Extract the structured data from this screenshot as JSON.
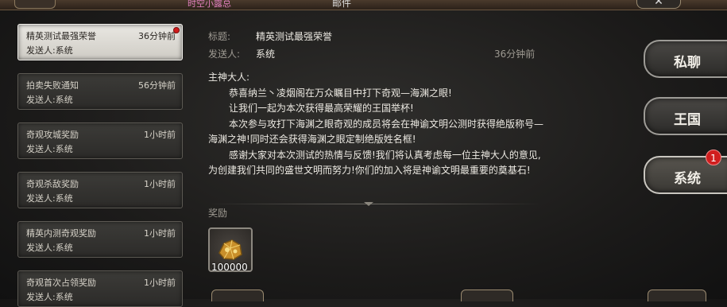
{
  "header": {
    "subtitle": "时空小露总",
    "title": "邮件",
    "close_glyph": "✕"
  },
  "mail_list": [
    {
      "subject": "精英测试最强荣誉",
      "time": "36分钟前",
      "sender": "发送人:系统",
      "unread": true,
      "active": true
    },
    {
      "subject": "拍卖失败通知",
      "time": "56分钟前",
      "sender": "发送人:系统"
    },
    {
      "subject": "奇观攻城奖励",
      "time": "1小时前",
      "sender": "发送人:系统"
    },
    {
      "subject": "奇观杀敌奖励",
      "time": "1小时前",
      "sender": "发送人:系统"
    },
    {
      "subject": "精英内测奇观奖励",
      "time": "1小时前",
      "sender": "发送人:系统"
    },
    {
      "subject": "奇观首次占领奖励",
      "time": "1小时前",
      "sender": "发送人:系统"
    }
  ],
  "mail": {
    "title_label": "标题:",
    "title_value": "精英测试最强荣誉",
    "sender_label": "发送人:",
    "sender_value": "系统",
    "time": "36分钟前",
    "greeting": "主神大人:",
    "paragraphs": [
      "恭喜纳兰丶凌烟阁在万众瞩目中打下奇观—海渊之眼!",
      "让我们一起为本次获得最高荣耀的王国举杯!",
      "本次参与攻打下海渊之眼奇观的成员将会在神谕文明公测时获得绝版称号—海渊之神!同时还会获得海渊之眼定制绝版姓名框!",
      "感谢大家对本次测试的热情与反馈!我们将认真考虑每一位主神大人的意见,为创建我们共同的盛世文明而努力!你们的加入将是神谕文明最重要的奠基石!"
    ],
    "reward_label": "奖励",
    "reward": {
      "icon": "gold-ore-icon",
      "quantity": "100000"
    }
  },
  "tabs": [
    {
      "label": "私聊"
    },
    {
      "label": "王国"
    },
    {
      "label": "系统",
      "badge": "1",
      "active": true
    }
  ],
  "colors": {
    "badge": "#d01e1e",
    "accent_pink": "#e07fbd",
    "gold": "#d9a441"
  }
}
